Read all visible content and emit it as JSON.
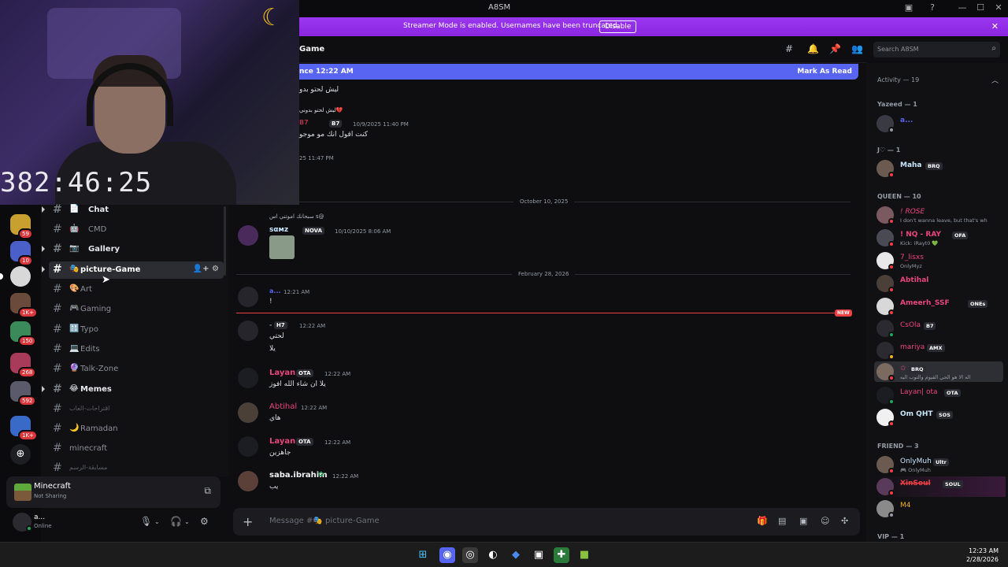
{
  "window": {
    "title": "A8SM"
  },
  "banner": {
    "text": "Streamer Mode is enabled. Usernames have been truncated.",
    "button": "Disable"
  },
  "webcam": {
    "timer": "382:46:25"
  },
  "server_badges": [
    "59",
    "10",
    "1K+",
    "150",
    "268",
    "592",
    "1K+"
  ],
  "channels": [
    {
      "emoji": "📄",
      "name": "Chat",
      "unread": true,
      "arrow": true
    },
    {
      "emoji": "🤖",
      "name": "CMD",
      "unread": false
    },
    {
      "emoji": "📷",
      "name": "Gallery",
      "unread": true,
      "arrow": true
    },
    {
      "emoji": "🎭",
      "name": "picture-Game",
      "active": true
    },
    {
      "emoji": "🎨",
      "name": "Art",
      "unread": false
    },
    {
      "emoji": "🎮",
      "name": "Gaming",
      "unread": false
    },
    {
      "emoji": "🔠",
      "name": "Typo",
      "unread": false
    },
    {
      "emoji": "💻",
      "name": "Edits",
      "unread": false
    },
    {
      "emoji": "🔮",
      "name": "Talk-Zone",
      "unread": false
    },
    {
      "emoji": "😂",
      "name": "Memes",
      "unread": true,
      "arrow": true
    },
    {
      "emoji": "",
      "name": "اقتراحات-العاب",
      "unread": false,
      "dim": true
    },
    {
      "emoji": "🌙",
      "name": "Ramadan",
      "unread": false
    },
    {
      "emoji": "",
      "name": "minecraft",
      "unread": false
    },
    {
      "emoji": "",
      "name": "مسابقة-الرسم",
      "unread": false,
      "dim": true
    }
  ],
  "activity": {
    "game": "Minecraft",
    "status": "Not Sharing"
  },
  "user": {
    "name": "a...",
    "status": "Online"
  },
  "header": {
    "channel": "Game",
    "search_placeholder": "Search A8SM"
  },
  "new_messages": {
    "since": "nce 12:22 AM",
    "mark_read": "Mark As Read"
  },
  "messages": {
    "top_text1": "ليش لحتو بدو",
    "reply_text": "ليش لحتو بدوني💔",
    "m1_author": "B7",
    "m1_tag": "B7",
    "m1_time": "10/9/2025 11:40 PM",
    "m1_text": "كنت اقول انك مو موجو",
    "m1_time2": "25 11:47 PM",
    "date1": "October 10, 2025",
    "m2_reply": "سبحانك اموتني اس s@",
    "m2_author": "sαмz",
    "m2_tag": "NOVA",
    "m2_time": "10/10/2025 8:06 AM",
    "date2": "February 28, 2026",
    "m3_author": "a...",
    "m3_time": "12:21 AM",
    "m3_text": "!",
    "new_label": "NEW",
    "m4_author": "-",
    "m4_tag": "H7",
    "m4_time": "12:22 AM",
    "m4_text1": "لحتي",
    "m4_text2": "يلا",
    "m5_author": "Layan",
    "m5_tag": "OTA",
    "m5_time": "12:22 AM",
    "m5_text": "يلا ان شاء الله افوز",
    "m6_author": "Abtihal",
    "m6_time": "12:22 AM",
    "m6_text": "هاي",
    "m7_author": "Layan",
    "m7_tag": "OTA",
    "m7_time": "12:22 AM",
    "m7_text": "جاهزين",
    "m8_author": "saba.ibrahim",
    "m8_time": "12:22 AM",
    "m8_text": "يب"
  },
  "composer": {
    "placeholder": "Message #🎭 picture-Game"
  },
  "members": {
    "activity_header": "Activity — 19",
    "sections": [
      {
        "title": "Yazeed — 1",
        "members": [
          {
            "name": "a...",
            "color": "#5865f2",
            "status_color": "#949ba4"
          }
        ]
      },
      {
        "title": "J♡ — 1",
        "members": [
          {
            "name": "Maha",
            "tag": "BRQ",
            "color": "#c9e7ff",
            "status_color": "#f23f42"
          }
        ]
      },
      {
        "title": "QUEEN — 10",
        "members": [
          {
            "name": "! ROSE",
            "sub": "I don't wanna leave, but that's wh",
            "color": "#e8457a",
            "status_color": "#f23f42"
          },
          {
            "name": "! NQ - RAY",
            "tag": "OFA",
            "sub": "Kick: iRayt0 💚",
            "color": "#e8457a",
            "status_color": "#f23f42"
          },
          {
            "name": "7_lisxs",
            "sub": "OnlyMyz",
            "color": "#e8457a",
            "status_color": "#f23f42"
          },
          {
            "name": "Abtihal",
            "color": "#e8457a",
            "status_color": "#f23f42"
          },
          {
            "name": "Ameerh_SSF",
            "tag": "ONEs",
            "color": "#e8457a",
            "status_color": "#f23f42"
          },
          {
            "name": "CsOla",
            "tag": "B7",
            "color": "#e8457a",
            "status_color": "#23a55a"
          },
          {
            "name": "mariya",
            "tag": "AMX",
            "color": "#e8457a",
            "status_color": "#f0b232"
          },
          {
            "name": "✩",
            "tag": "BRQ",
            "sub": "اله الا هو الحي القيوم والتوب اليه",
            "color": "#e8457a",
            "status_color": "#f23f42",
            "highlight": true
          },
          {
            "name": "Layan| ota",
            "tag": "OTA",
            "color": "#e8457a",
            "status_color": "#23a55a"
          },
          {
            "name": "Om QHT",
            "tag": "SOS",
            "color": "#c9e7ff",
            "status_color": "#f23f42"
          }
        ]
      },
      {
        "title": "FRIEND — 3",
        "members": [
          {
            "name": "OnlyMuh",
            "tag": "Ultr",
            "sub": "🎮 OnlyMuh",
            "color": "#c9e7ff",
            "status_color": "#f23f42"
          },
          {
            "name": "XinSoul",
            "tag": "SOUL",
            "color": "#f23f42",
            "status_color": "#f23f42"
          },
          {
            "name": "M4",
            "color": "#f0b232",
            "status_color": "#949ba4"
          }
        ]
      },
      {
        "title": "VIP — 1",
        "members": []
      }
    ]
  },
  "taskbar": {
    "time": "12:23 AM",
    "date": "2/28/2026"
  }
}
